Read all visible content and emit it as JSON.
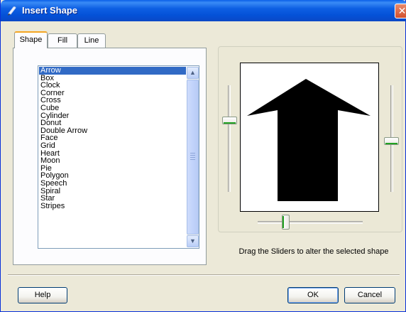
{
  "window": {
    "title": "Insert Shape",
    "close_label": "✕"
  },
  "tabs": [
    {
      "label": "Shape",
      "active": true
    },
    {
      "label": "Fill",
      "active": false
    },
    {
      "label": "Line",
      "active": false
    }
  ],
  "shape_list": {
    "selected": "Arrow",
    "items": [
      "Arrow",
      "Box",
      "Clock",
      "Corner",
      "Cross",
      "Cube",
      "Cylinder",
      "Donut",
      "Double Arrow",
      "Face",
      "Grid",
      "Heart",
      "Moon",
      "Pie",
      "Polygon",
      "Speech",
      "Spiral",
      "Star",
      "Stripes"
    ]
  },
  "sliders": {
    "left_vertical_level": 0.35,
    "right_vertical_level": 0.57,
    "bottom_horizontal_level": 0.27
  },
  "preview": {
    "shape": "arrow",
    "fill_color": "#000000"
  },
  "hint_text": "Drag the Sliders to alter the selected shape",
  "buttons": {
    "help": "Help",
    "ok": "OK",
    "cancel": "Cancel"
  }
}
